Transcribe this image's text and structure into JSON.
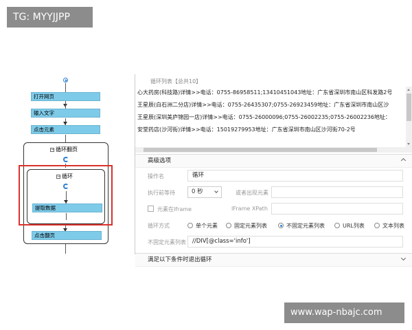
{
  "watermarks": {
    "top_left": "TG: MYYJJPP",
    "bottom_right": "www.wap-nbajc.com"
  },
  "flow": {
    "steps": [
      "打开网页",
      "输入文字",
      "点击元素"
    ],
    "outer_loop": "循环翻页",
    "inner_loop": "循环",
    "extract": "提取数据",
    "click_page": "点击翻页"
  },
  "panel": {
    "list_header": "循环列表【总共10】",
    "rows": [
      "心大药房(科技路)详情>>电话：0755-86958511;13410451043地址：广东省深圳市南山区科发路2号",
      "王星辰(白石洲二分店)详情>>电话：0755-26435307;0755-26923459地址：广东省深圳市南山区沙",
      "王星辰(深圳美庐锦园一店)详情>>电话：0755-26000096;0755-26002235;0755-26002236地址：",
      "安堂药店(沙河街)详情>>电话：15019279953地址：广东省深圳市南山区沙河街70-2号"
    ],
    "advanced": "高级选项",
    "op_name_label": "操作名",
    "op_name_value": "循环",
    "wait_label": "执行前等待",
    "wait_value": "0 秒",
    "or_label": "或者出现元素",
    "iframe_label": "元素在Iframe",
    "iframe_xpath_label": "IFrame XPath",
    "loop_mode_label": "循环方式",
    "loop_options": [
      "单个元素",
      "固定元素列表",
      "不固定元素列表",
      "URL列表",
      "文本列表"
    ],
    "loop_selected": 2,
    "unfixed_label": "不固定元素列表",
    "unfixed_value": "//DIV[@class='info']",
    "exit_condition": "满足以下条件时退出循环"
  }
}
